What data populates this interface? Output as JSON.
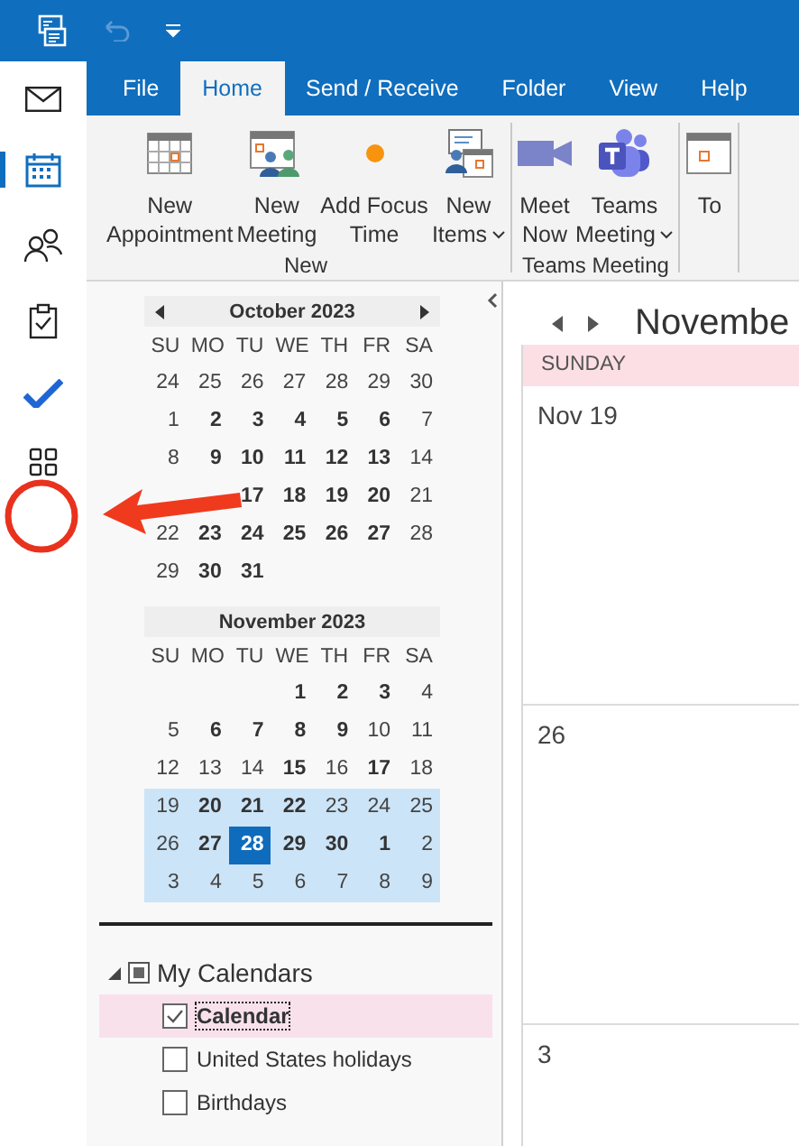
{
  "tabs": [
    {
      "label": "File",
      "selected": false
    },
    {
      "label": "Home",
      "selected": true
    },
    {
      "label": "Send / Receive",
      "selected": false
    },
    {
      "label": "Folder",
      "selected": false
    },
    {
      "label": "View",
      "selected": false
    },
    {
      "label": "Help",
      "selected": false
    }
  ],
  "ribbon": {
    "groups": [
      {
        "label": "New",
        "buttons": [
          {
            "kind": "appointment",
            "lines": [
              "New",
              "Appointment"
            ],
            "dropdown": false
          },
          {
            "kind": "meeting",
            "lines": [
              "New",
              "Meeting"
            ],
            "dropdown": false
          },
          {
            "kind": "focus",
            "lines": [
              "Add Focus",
              "Time"
            ],
            "dropdown": false
          },
          {
            "kind": "items",
            "lines": [
              "New",
              "Items"
            ],
            "dropdown": true
          }
        ]
      },
      {
        "label": "Teams Meeting",
        "buttons": [
          {
            "kind": "meet-now",
            "lines": [
              "Meet",
              "Now"
            ],
            "dropdown": false
          },
          {
            "kind": "teams",
            "lines": [
              "Teams",
              "Meeting"
            ],
            "dropdown": true
          }
        ]
      },
      {
        "buttons": [
          {
            "kind": "today",
            "lines": [
              "To"
            ],
            "dropdown": false
          }
        ]
      }
    ]
  },
  "mini_calendars": [
    {
      "title": "October 2023",
      "nav": true,
      "weekdays": [
        "SU",
        "MO",
        "TU",
        "WE",
        "TH",
        "FR",
        "SA"
      ],
      "weeks": [
        {
          "selected": false,
          "days": [
            {
              "d": "24",
              "bold": false,
              "today": false
            },
            {
              "d": "25",
              "bold": false,
              "today": false
            },
            {
              "d": "26",
              "bold": false,
              "today": false
            },
            {
              "d": "27",
              "bold": false,
              "today": false
            },
            {
              "d": "28",
              "bold": false,
              "today": false
            },
            {
              "d": "29",
              "bold": false,
              "today": false
            },
            {
              "d": "30",
              "bold": false,
              "today": false
            }
          ]
        },
        {
          "selected": false,
          "days": [
            {
              "d": "1",
              "bold": false,
              "today": false
            },
            {
              "d": "2",
              "bold": true,
              "today": false
            },
            {
              "d": "3",
              "bold": true,
              "today": false
            },
            {
              "d": "4",
              "bold": true,
              "today": false
            },
            {
              "d": "5",
              "bold": true,
              "today": false
            },
            {
              "d": "6",
              "bold": true,
              "today": false
            },
            {
              "d": "7",
              "bold": false,
              "today": false
            }
          ]
        },
        {
          "selected": false,
          "days": [
            {
              "d": "8",
              "bold": false,
              "today": false
            },
            {
              "d": "9",
              "bold": true,
              "today": false
            },
            {
              "d": "10",
              "bold": true,
              "today": false
            },
            {
              "d": "11",
              "bold": true,
              "today": false
            },
            {
              "d": "12",
              "bold": true,
              "today": false
            },
            {
              "d": "13",
              "bold": true,
              "today": false
            },
            {
              "d": "14",
              "bold": false,
              "today": false
            }
          ]
        },
        {
          "selected": false,
          "right_aligned": true,
          "days": [
            {
              "d": "17",
              "bold": true,
              "today": false
            },
            {
              "d": "18",
              "bold": true,
              "today": false
            },
            {
              "d": "19",
              "bold": true,
              "today": false
            },
            {
              "d": "20",
              "bold": true,
              "today": false
            },
            {
              "d": "21",
              "bold": false,
              "today": false
            }
          ]
        },
        {
          "selected": false,
          "days": [
            {
              "d": "22",
              "bold": false,
              "today": false
            },
            {
              "d": "23",
              "bold": true,
              "today": false
            },
            {
              "d": "24",
              "bold": true,
              "today": false
            },
            {
              "d": "25",
              "bold": true,
              "today": false
            },
            {
              "d": "26",
              "bold": true,
              "today": false
            },
            {
              "d": "27",
              "bold": true,
              "today": false
            },
            {
              "d": "28",
              "bold": false,
              "today": false
            }
          ]
        },
        {
          "selected": false,
          "days": [
            {
              "d": "29",
              "bold": false,
              "today": false
            },
            {
              "d": "30",
              "bold": true,
              "today": false
            },
            {
              "d": "31",
              "bold": true,
              "today": false
            }
          ]
        }
      ]
    },
    {
      "title": "November 2023",
      "nav": false,
      "weekdays": [
        "SU",
        "MO",
        "TU",
        "WE",
        "TH",
        "FR",
        "SA"
      ],
      "weeks": [
        {
          "selected": false,
          "right_aligned": true,
          "days": [
            {
              "d": "1",
              "bold": true,
              "today": false
            },
            {
              "d": "2",
              "bold": true,
              "today": false
            },
            {
              "d": "3",
              "bold": true,
              "today": false
            },
            {
              "d": "4",
              "bold": false,
              "today": false
            }
          ]
        },
        {
          "selected": false,
          "days": [
            {
              "d": "5",
              "bold": false,
              "today": false
            },
            {
              "d": "6",
              "bold": true,
              "today": false
            },
            {
              "d": "7",
              "bold": true,
              "today": false
            },
            {
              "d": "8",
              "bold": true,
              "today": false
            },
            {
              "d": "9",
              "bold": true,
              "today": false
            },
            {
              "d": "10",
              "bold": false,
              "today": false
            },
            {
              "d": "11",
              "bold": false,
              "today": false
            }
          ]
        },
        {
          "selected": false,
          "days": [
            {
              "d": "12",
              "bold": false,
              "today": false
            },
            {
              "d": "13",
              "bold": false,
              "today": false
            },
            {
              "d": "14",
              "bold": false,
              "today": false
            },
            {
              "d": "15",
              "bold": true,
              "today": false
            },
            {
              "d": "16",
              "bold": false,
              "today": false
            },
            {
              "d": "17",
              "bold": true,
              "today": false
            },
            {
              "d": "18",
              "bold": false,
              "today": false
            }
          ]
        },
        {
          "selected": true,
          "days": [
            {
              "d": "19",
              "bold": false,
              "today": false
            },
            {
              "d": "20",
              "bold": true,
              "today": false
            },
            {
              "d": "21",
              "bold": true,
              "today": false
            },
            {
              "d": "22",
              "bold": true,
              "today": false
            },
            {
              "d": "23",
              "bold": false,
              "today": false
            },
            {
              "d": "24",
              "bold": false,
              "today": false
            },
            {
              "d": "25",
              "bold": false,
              "today": false
            }
          ]
        },
        {
          "selected": true,
          "days": [
            {
              "d": "26",
              "bold": false,
              "today": false
            },
            {
              "d": "27",
              "bold": true,
              "today": false
            },
            {
              "d": "28",
              "bold": true,
              "today": true
            },
            {
              "d": "29",
              "bold": true,
              "today": false
            },
            {
              "d": "30",
              "bold": true,
              "today": false
            },
            {
              "d": "1",
              "bold": true,
              "today": false
            },
            {
              "d": "2",
              "bold": false,
              "today": false
            }
          ]
        },
        {
          "selected": true,
          "days": [
            {
              "d": "3",
              "bold": false,
              "today": false
            },
            {
              "d": "4",
              "bold": false,
              "today": false
            },
            {
              "d": "5",
              "bold": false,
              "today": false
            },
            {
              "d": "6",
              "bold": false,
              "today": false
            },
            {
              "d": "7",
              "bold": false,
              "today": false
            },
            {
              "d": "8",
              "bold": false,
              "today": false
            },
            {
              "d": "9",
              "bold": false,
              "today": false
            }
          ]
        }
      ]
    }
  ],
  "calendar_groups": [
    {
      "label": "My Calendars",
      "expanded": true,
      "items": [
        {
          "label": "Calendar",
          "checked": true,
          "selected": true
        },
        {
          "label": "United States holidays",
          "checked": false,
          "selected": false
        },
        {
          "label": "Birthdays",
          "checked": false,
          "selected": false
        }
      ]
    }
  ],
  "main": {
    "title": "Novembe",
    "day_header": "SUNDAY",
    "cells": [
      "Nov 19",
      "26",
      "3"
    ]
  }
}
